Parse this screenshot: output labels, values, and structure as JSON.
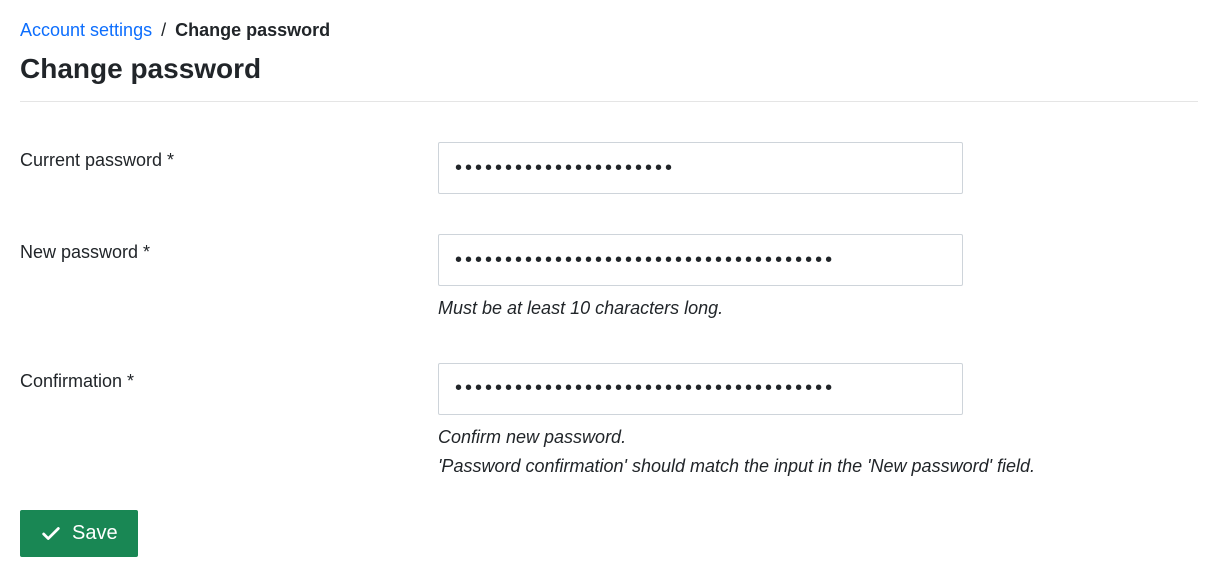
{
  "breadcrumb": {
    "parent": "Account settings",
    "separator": "/",
    "current": "Change password"
  },
  "page_title": "Change password",
  "form": {
    "current_password": {
      "label": "Current password *",
      "value": "••••••••••••••••••••••"
    },
    "new_password": {
      "label": "New password *",
      "value": "••••••••••••••••••••••••••••••••••••••",
      "help": "Must be at least 10 characters long."
    },
    "confirmation": {
      "label": "Confirmation *",
      "value": "••••••••••••••••••••••••••••••••••••••",
      "help_line1": "Confirm new password.",
      "help_line2": "'Password confirmation' should match the input in the 'New password' field."
    }
  },
  "actions": {
    "save_label": "Save"
  }
}
